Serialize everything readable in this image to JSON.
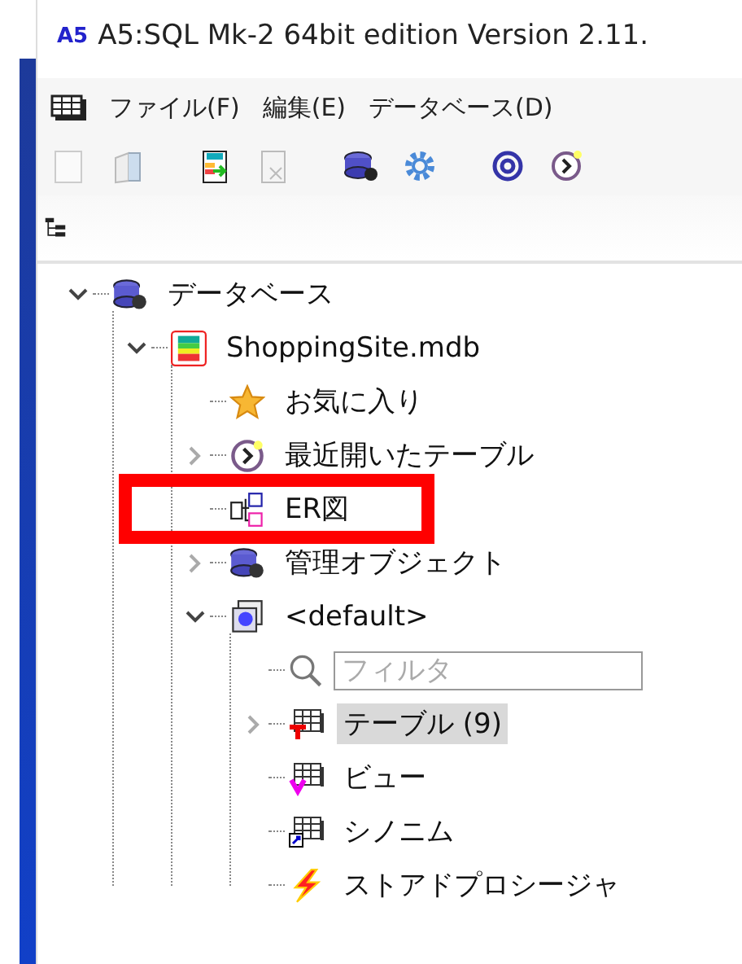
{
  "window": {
    "logo": "A5",
    "title": "A5:SQL Mk-2 64bit edition Version 2.11."
  },
  "menu": [
    "ファイル(F)",
    "編集(E)",
    "データベース(D)"
  ],
  "tree": [
    {
      "kind": "database",
      "label": "データベース",
      "expanded": true,
      "selected": false,
      "children": [
        {
          "kind": "file",
          "label": "ShoppingSite.mdb",
          "expanded": true,
          "selected": false,
          "children": [
            {
              "kind": "favorites",
              "label": "お気に入り",
              "selected": false
            },
            {
              "kind": "history",
              "label": "最近開いたテーブル",
              "expanded": false,
              "selected": false
            },
            {
              "kind": "diagram",
              "label": "ER図",
              "selected": false,
              "highlighted": true
            },
            {
              "kind": "objects",
              "label": "管理オブジェクト",
              "expanded": false,
              "selected": false
            },
            {
              "kind": "schema",
              "label": "<default>",
              "expanded": true,
              "selected": false,
              "children": [
                {
                  "kind": "filter",
                  "placeholder": "フィルタ"
                },
                {
                  "kind": "tables",
                  "label": "テーブル (9)",
                  "expanded": false,
                  "selected": true
                },
                {
                  "kind": "views",
                  "label": "ビュー",
                  "selected": false
                },
                {
                  "kind": "synonyms",
                  "label": "シノニム",
                  "selected": false
                },
                {
                  "kind": "procedures",
                  "label": "ストアドプロシージャ",
                  "selected": false
                }
              ]
            }
          ]
        }
      ]
    }
  ]
}
